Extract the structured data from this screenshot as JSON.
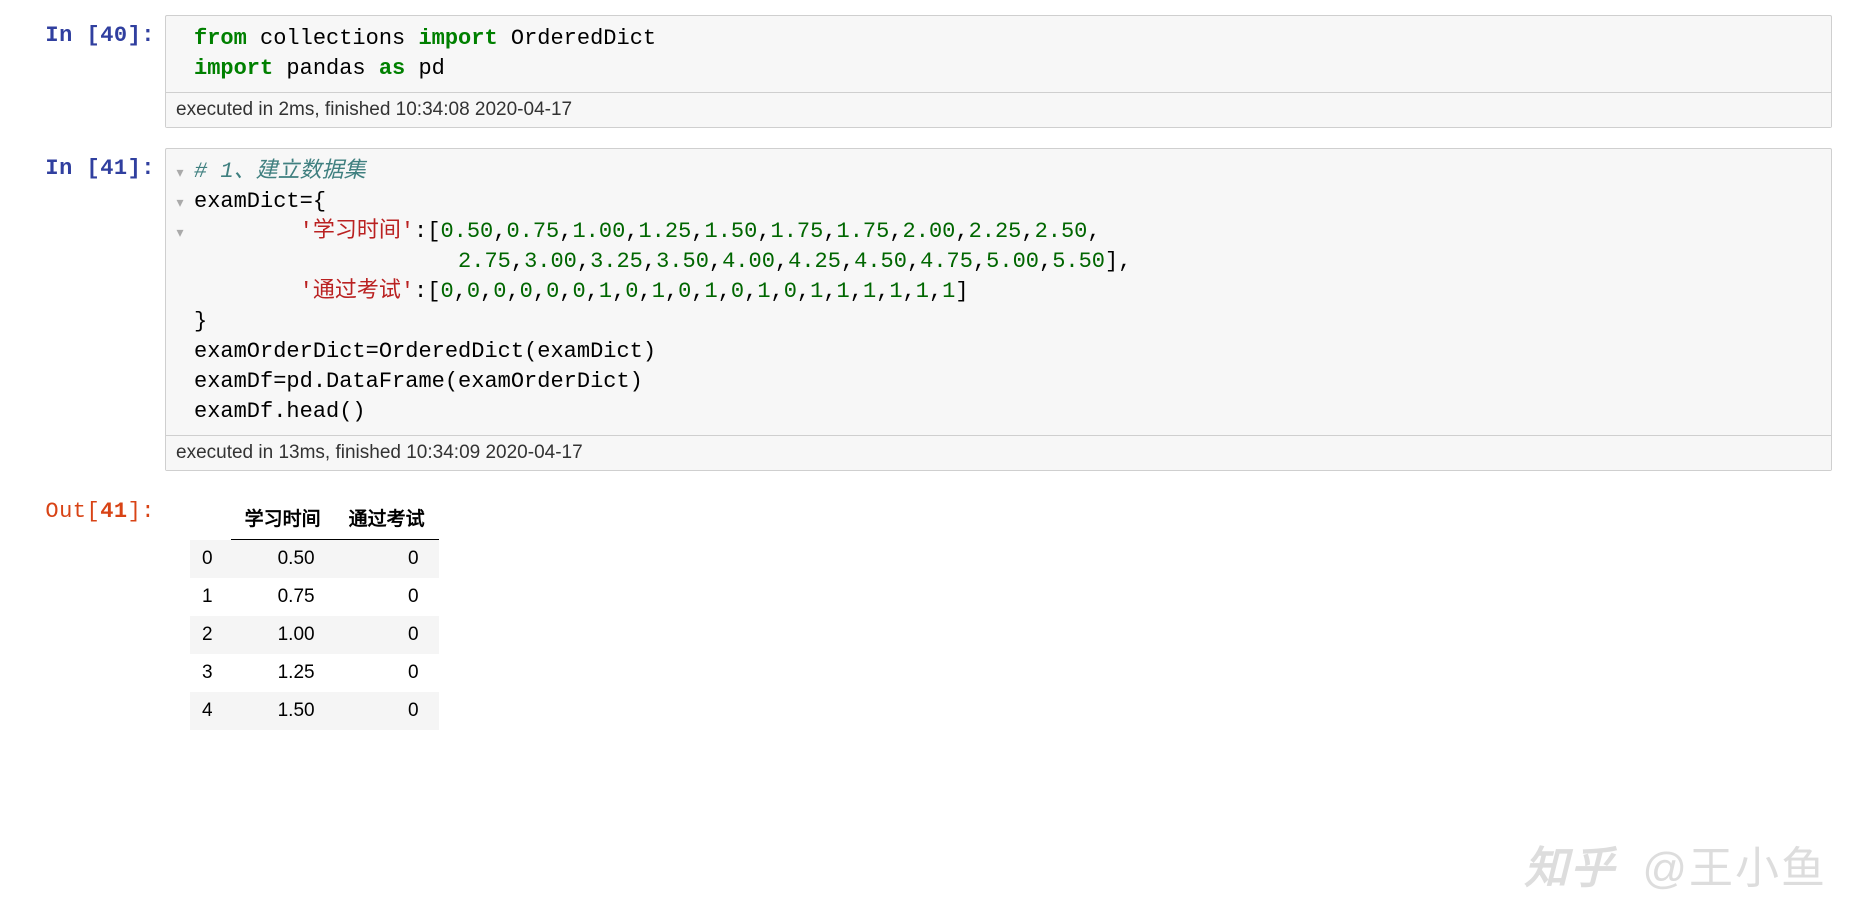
{
  "cells": [
    {
      "prompt_type": "In",
      "prompt_num": "40",
      "exec_meta": "executed in 2ms, finished 10:34:08 2020-04-17",
      "lines": [
        [
          {
            "cls": "k-green",
            "t": "from"
          },
          {
            "cls": "k-plain",
            "t": " collections "
          },
          {
            "cls": "k-green",
            "t": "import"
          },
          {
            "cls": "k-plain",
            "t": " OrderedDict"
          }
        ],
        [
          {
            "cls": "k-green",
            "t": "import"
          },
          {
            "cls": "k-plain",
            "t": " pandas "
          },
          {
            "cls": "k-green",
            "t": "as"
          },
          {
            "cls": "k-plain",
            "t": " pd"
          }
        ]
      ],
      "fold_markers": []
    },
    {
      "prompt_type": "In",
      "prompt_num": "41",
      "exec_meta": "executed in 13ms, finished 10:34:09 2020-04-17",
      "fold_markers": [
        "▾",
        "▾",
        "▾",
        "",
        "",
        "",
        "",
        "",
        ""
      ],
      "lines": [
        [
          {
            "cls": "k-comment",
            "t": "# 1、建立数据集"
          }
        ],
        [
          {
            "cls": "k-plain",
            "t": "examDict"
          },
          {
            "cls": "k-plain",
            "t": "="
          },
          {
            "cls": "k-plain",
            "t": "{"
          }
        ],
        [
          {
            "cls": "k-plain",
            "t": "        "
          },
          {
            "cls": "k-red",
            "t": "'学习时间'"
          },
          {
            "cls": "k-plain",
            "t": ":["
          },
          {
            "cls": "k-num",
            "t": "0.50"
          },
          {
            "cls": "k-plain",
            "t": ","
          },
          {
            "cls": "k-num",
            "t": "0.75"
          },
          {
            "cls": "k-plain",
            "t": ","
          },
          {
            "cls": "k-num",
            "t": "1.00"
          },
          {
            "cls": "k-plain",
            "t": ","
          },
          {
            "cls": "k-num",
            "t": "1.25"
          },
          {
            "cls": "k-plain",
            "t": ","
          },
          {
            "cls": "k-num",
            "t": "1.50"
          },
          {
            "cls": "k-plain",
            "t": ","
          },
          {
            "cls": "k-num",
            "t": "1.75"
          },
          {
            "cls": "k-plain",
            "t": ","
          },
          {
            "cls": "k-num",
            "t": "1.75"
          },
          {
            "cls": "k-plain",
            "t": ","
          },
          {
            "cls": "k-num",
            "t": "2.00"
          },
          {
            "cls": "k-plain",
            "t": ","
          },
          {
            "cls": "k-num",
            "t": "2.25"
          },
          {
            "cls": "k-plain",
            "t": ","
          },
          {
            "cls": "k-num",
            "t": "2.50"
          },
          {
            "cls": "k-plain",
            "t": ","
          }
        ],
        [
          {
            "cls": "k-plain",
            "t": "                    "
          },
          {
            "cls": "k-num",
            "t": "2.75"
          },
          {
            "cls": "k-plain",
            "t": ","
          },
          {
            "cls": "k-num",
            "t": "3.00"
          },
          {
            "cls": "k-plain",
            "t": ","
          },
          {
            "cls": "k-num",
            "t": "3.25"
          },
          {
            "cls": "k-plain",
            "t": ","
          },
          {
            "cls": "k-num",
            "t": "3.50"
          },
          {
            "cls": "k-plain",
            "t": ","
          },
          {
            "cls": "k-num",
            "t": "4.00"
          },
          {
            "cls": "k-plain",
            "t": ","
          },
          {
            "cls": "k-num",
            "t": "4.25"
          },
          {
            "cls": "k-plain",
            "t": ","
          },
          {
            "cls": "k-num",
            "t": "4.50"
          },
          {
            "cls": "k-plain",
            "t": ","
          },
          {
            "cls": "k-num",
            "t": "4.75"
          },
          {
            "cls": "k-plain",
            "t": ","
          },
          {
            "cls": "k-num",
            "t": "5.00"
          },
          {
            "cls": "k-plain",
            "t": ","
          },
          {
            "cls": "k-num",
            "t": "5.50"
          },
          {
            "cls": "k-plain",
            "t": "],"
          }
        ],
        [
          {
            "cls": "k-plain",
            "t": "        "
          },
          {
            "cls": "k-red",
            "t": "'通过考试'"
          },
          {
            "cls": "k-plain",
            "t": ":["
          },
          {
            "cls": "k-num",
            "t": "0"
          },
          {
            "cls": "k-plain",
            "t": ","
          },
          {
            "cls": "k-num",
            "t": "0"
          },
          {
            "cls": "k-plain",
            "t": ","
          },
          {
            "cls": "k-num",
            "t": "0"
          },
          {
            "cls": "k-plain",
            "t": ","
          },
          {
            "cls": "k-num",
            "t": "0"
          },
          {
            "cls": "k-plain",
            "t": ","
          },
          {
            "cls": "k-num",
            "t": "0"
          },
          {
            "cls": "k-plain",
            "t": ","
          },
          {
            "cls": "k-num",
            "t": "0"
          },
          {
            "cls": "k-plain",
            "t": ","
          },
          {
            "cls": "k-num",
            "t": "1"
          },
          {
            "cls": "k-plain",
            "t": ","
          },
          {
            "cls": "k-num",
            "t": "0"
          },
          {
            "cls": "k-plain",
            "t": ","
          },
          {
            "cls": "k-num",
            "t": "1"
          },
          {
            "cls": "k-plain",
            "t": ","
          },
          {
            "cls": "k-num",
            "t": "0"
          },
          {
            "cls": "k-plain",
            "t": ","
          },
          {
            "cls": "k-num",
            "t": "1"
          },
          {
            "cls": "k-plain",
            "t": ","
          },
          {
            "cls": "k-num",
            "t": "0"
          },
          {
            "cls": "k-plain",
            "t": ","
          },
          {
            "cls": "k-num",
            "t": "1"
          },
          {
            "cls": "k-plain",
            "t": ","
          },
          {
            "cls": "k-num",
            "t": "0"
          },
          {
            "cls": "k-plain",
            "t": ","
          },
          {
            "cls": "k-num",
            "t": "1"
          },
          {
            "cls": "k-plain",
            "t": ","
          },
          {
            "cls": "k-num",
            "t": "1"
          },
          {
            "cls": "k-plain",
            "t": ","
          },
          {
            "cls": "k-num",
            "t": "1"
          },
          {
            "cls": "k-plain",
            "t": ","
          },
          {
            "cls": "k-num",
            "t": "1"
          },
          {
            "cls": "k-plain",
            "t": ","
          },
          {
            "cls": "k-num",
            "t": "1"
          },
          {
            "cls": "k-plain",
            "t": ","
          },
          {
            "cls": "k-num",
            "t": "1"
          },
          {
            "cls": "k-plain",
            "t": "]"
          }
        ],
        [
          {
            "cls": "k-plain",
            "t": "}"
          }
        ],
        [
          {
            "cls": "k-plain",
            "t": "examOrderDict"
          },
          {
            "cls": "k-plain",
            "t": "="
          },
          {
            "cls": "k-plain",
            "t": "OrderedDict(examDict)"
          }
        ],
        [
          {
            "cls": "k-plain",
            "t": "examDf"
          },
          {
            "cls": "k-plain",
            "t": "="
          },
          {
            "cls": "k-plain",
            "t": "pd.DataFrame(examOrderDict)"
          }
        ],
        [
          {
            "cls": "k-plain",
            "t": "examDf.head()"
          }
        ]
      ]
    }
  ],
  "out_prompt": {
    "type": "Out",
    "num": "41"
  },
  "dataframe": {
    "columns": [
      "学习时间",
      "通过考试"
    ],
    "index": [
      "0",
      "1",
      "2",
      "3",
      "4"
    ],
    "rows": [
      [
        "0.50",
        "0"
      ],
      [
        "0.75",
        "0"
      ],
      [
        "1.00",
        "0"
      ],
      [
        "1.25",
        "0"
      ],
      [
        "1.50",
        "0"
      ]
    ]
  },
  "watermark": {
    "logo": "知乎",
    "author": "@王小鱼"
  },
  "chart_data": {
    "type": "table",
    "title": "examDf.head()",
    "columns": [
      "学习时间",
      "通过考试"
    ],
    "rows": [
      {
        "index": 0,
        "学习时间": 0.5,
        "通过考试": 0
      },
      {
        "index": 1,
        "学习时间": 0.75,
        "通过考试": 0
      },
      {
        "index": 2,
        "学习时间": 1.0,
        "通过考试": 0
      },
      {
        "index": 3,
        "学习时间": 1.25,
        "通过考试": 0
      },
      {
        "index": 4,
        "学习时间": 1.5,
        "通过考试": 0
      }
    ]
  }
}
